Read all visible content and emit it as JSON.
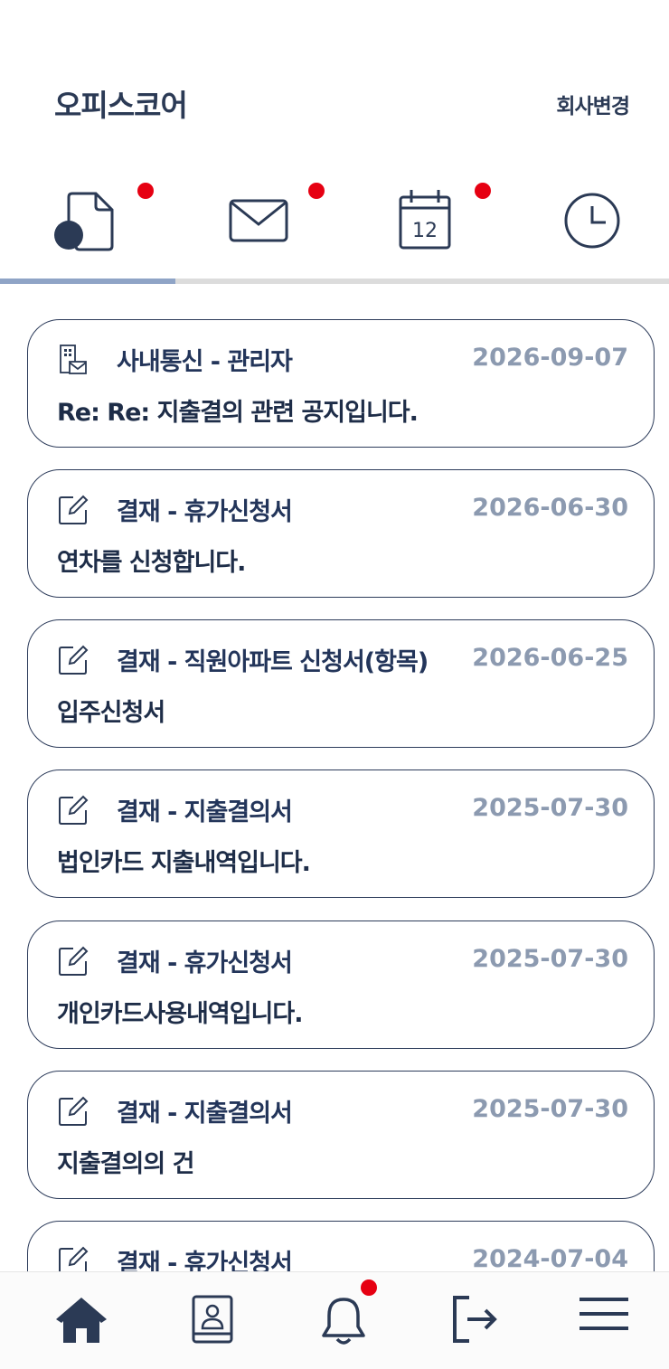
{
  "header": {
    "title": "오피스코어",
    "company_change_label": "회사변경"
  },
  "tabs": [
    {
      "name": "approval-doc",
      "icon": "document-icon",
      "badge": true,
      "active": true
    },
    {
      "name": "mail",
      "icon": "mail-icon",
      "badge": true,
      "active": false
    },
    {
      "name": "calendar",
      "icon": "calendar-icon",
      "badge": true,
      "active": false,
      "calendar_day": "12"
    },
    {
      "name": "history",
      "icon": "clock-icon",
      "badge": false,
      "active": false
    }
  ],
  "items": [
    {
      "icon": "internal-message-icon",
      "category": "사내통신 - 관리자",
      "date": "2026-09-07",
      "subject": "Re: Re: 지출결의 관련 공지입니다."
    },
    {
      "icon": "edit-icon",
      "category": "결재 - 휴가신청서",
      "date": "2026-06-30",
      "subject": "연차를 신청합니다."
    },
    {
      "icon": "edit-icon",
      "category": "결재 - 직원아파트 신청서(항목)",
      "date": "2026-06-25",
      "subject": "입주신청서"
    },
    {
      "icon": "edit-icon",
      "category": "결재 - 지출결의서",
      "date": "2025-07-30",
      "subject": "법인카드 지출내역입니다."
    },
    {
      "icon": "edit-icon",
      "category": "결재 - 휴가신청서",
      "date": "2025-07-30",
      "subject": "개인카드사용내역입니다."
    },
    {
      "icon": "edit-icon",
      "category": "결재 - 지출결의서",
      "date": "2025-07-30",
      "subject": "지출결의의 건"
    },
    {
      "icon": "edit-icon",
      "category": "결재 - 휴가신청서",
      "date": "2024-07-04",
      "subject": ""
    }
  ],
  "bottom_nav": [
    {
      "icon": "home-icon",
      "badge": false
    },
    {
      "icon": "contacts-icon",
      "badge": false
    },
    {
      "icon": "bell-icon",
      "badge": true
    },
    {
      "icon": "logout-icon",
      "badge": false
    },
    {
      "icon": "menu-icon",
      "badge": false
    }
  ],
  "colors": {
    "primary": "#2b3a55",
    "badge": "#e60012",
    "date": "#8c9ab0",
    "tab_active": "#8fa4c6"
  }
}
